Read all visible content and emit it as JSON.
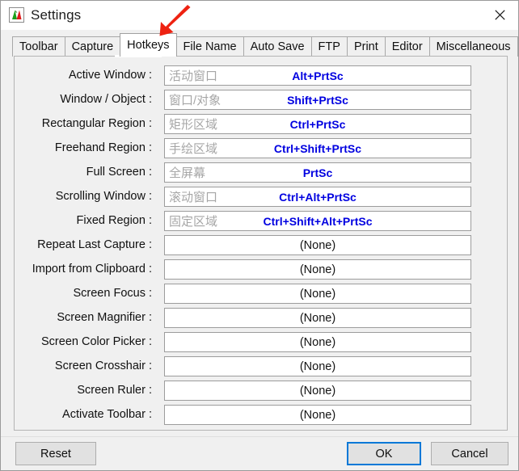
{
  "window": {
    "title": "Settings",
    "app_icon": "faststone-capture-icon",
    "close_label": "✕"
  },
  "tabs": [
    {
      "label": "Toolbar",
      "active": false
    },
    {
      "label": "Capture",
      "active": false
    },
    {
      "label": "Hotkeys",
      "active": true
    },
    {
      "label": "File Name",
      "active": false
    },
    {
      "label": "Auto Save",
      "active": false
    },
    {
      "label": "FTP",
      "active": false
    },
    {
      "label": "Print",
      "active": false
    },
    {
      "label": "Editor",
      "active": false
    },
    {
      "label": "Miscellaneous",
      "active": false
    }
  ],
  "annotation": {
    "shape": "red-arrow",
    "color": "#ee2211",
    "points_to": "Hotkeys"
  },
  "hotkeys": {
    "none_text": "(None)",
    "accent_color": "#0000e0",
    "rows": [
      {
        "label": "Active Window :",
        "placeholder": "活动窗口",
        "value": "Alt+PrtSc",
        "is_none": false
      },
      {
        "label": "Window / Object :",
        "placeholder": "窗口/对象",
        "value": "Shift+PrtSc",
        "is_none": false
      },
      {
        "label": "Rectangular Region :",
        "placeholder": "矩形区域",
        "value": "Ctrl+PrtSc",
        "is_none": false
      },
      {
        "label": "Freehand Region :",
        "placeholder": "手绘区域",
        "value": "Ctrl+Shift+PrtSc",
        "is_none": false
      },
      {
        "label": "Full Screen :",
        "placeholder": "全屏幕",
        "value": "PrtSc",
        "is_none": false
      },
      {
        "label": "Scrolling Window :",
        "placeholder": "滚动窗口",
        "value": "Ctrl+Alt+PrtSc",
        "is_none": false
      },
      {
        "label": "Fixed Region :",
        "placeholder": "固定区域",
        "value": "Ctrl+Shift+Alt+PrtSc",
        "is_none": false
      },
      {
        "label": "Repeat Last Capture :",
        "placeholder": "",
        "value": "(None)",
        "is_none": true
      },
      {
        "label": "Import from Clipboard :",
        "placeholder": "",
        "value": "(None)",
        "is_none": true
      },
      {
        "label": "Screen Focus :",
        "placeholder": "",
        "value": "(None)",
        "is_none": true
      },
      {
        "label": "Screen Magnifier :",
        "placeholder": "",
        "value": "(None)",
        "is_none": true
      },
      {
        "label": "Screen Color Picker :",
        "placeholder": "",
        "value": "(None)",
        "is_none": true
      },
      {
        "label": "Screen Crosshair :",
        "placeholder": "",
        "value": "(None)",
        "is_none": true
      },
      {
        "label": "Screen Ruler :",
        "placeholder": "",
        "value": "(None)",
        "is_none": true
      },
      {
        "label": "Activate Toolbar :",
        "placeholder": "",
        "value": "(None)",
        "is_none": true
      }
    ]
  },
  "footer": {
    "reset_label": "Reset",
    "ok_label": "OK",
    "cancel_label": "Cancel",
    "focus_color": "#0078d7"
  }
}
